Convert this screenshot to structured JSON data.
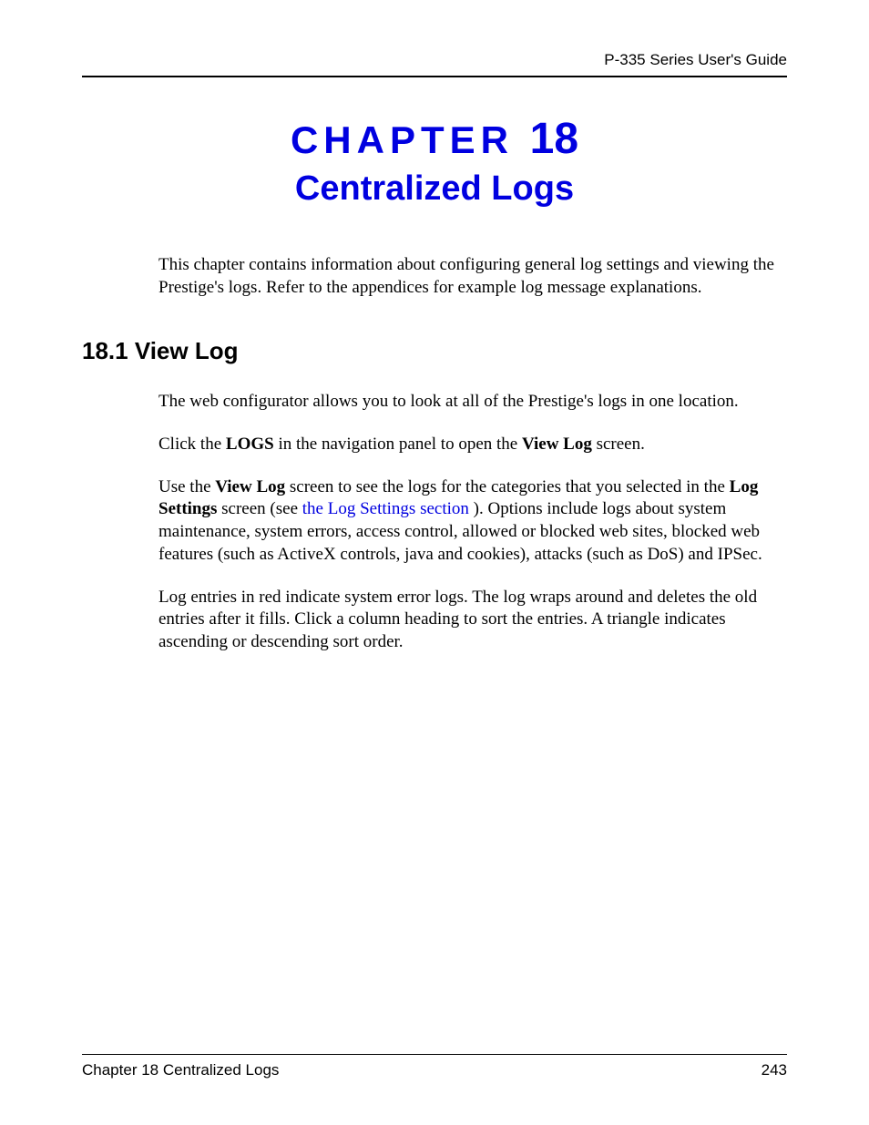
{
  "header": {
    "guide_title": "P-335 Series User's Guide"
  },
  "chapter": {
    "label_word": "CHAPTER",
    "number": "18",
    "title": "Centralized Logs"
  },
  "intro": {
    "text": "This chapter contains information about configuring general log settings and viewing the Prestige's logs. Refer to the appendices for example log message explanations."
  },
  "section": {
    "heading": "18.1  View Log",
    "p1": "The web configurator allows you to look at all of the Prestige's logs in one location.",
    "p2_pre": "Click the ",
    "p2_bold1": "LOGS",
    "p2_mid": " in the navigation panel to open the ",
    "p2_bold2": "View Log",
    "p2_post": " screen.",
    "p3_pre": "Use the ",
    "p3_bold1": "View Log",
    "p3_mid1": " screen to see the logs for the categories that you selected in the ",
    "p3_bold2": "Log Settings",
    "p3_mid2": " screen (see ",
    "p3_link": "the Log Settings section ",
    "p3_post": "). Options include logs about system maintenance, system errors, access control, allowed or blocked web sites, blocked web features (such as ActiveX controls, java and cookies), attacks (such as DoS) and IPSec.",
    "p4": "Log entries in red indicate system error logs. The log wraps around and deletes the old entries after it fills. Click a column heading to sort the entries. A triangle indicates ascending or descending sort order."
  },
  "footer": {
    "left": "Chapter 18 Centralized Logs",
    "right": "243"
  }
}
